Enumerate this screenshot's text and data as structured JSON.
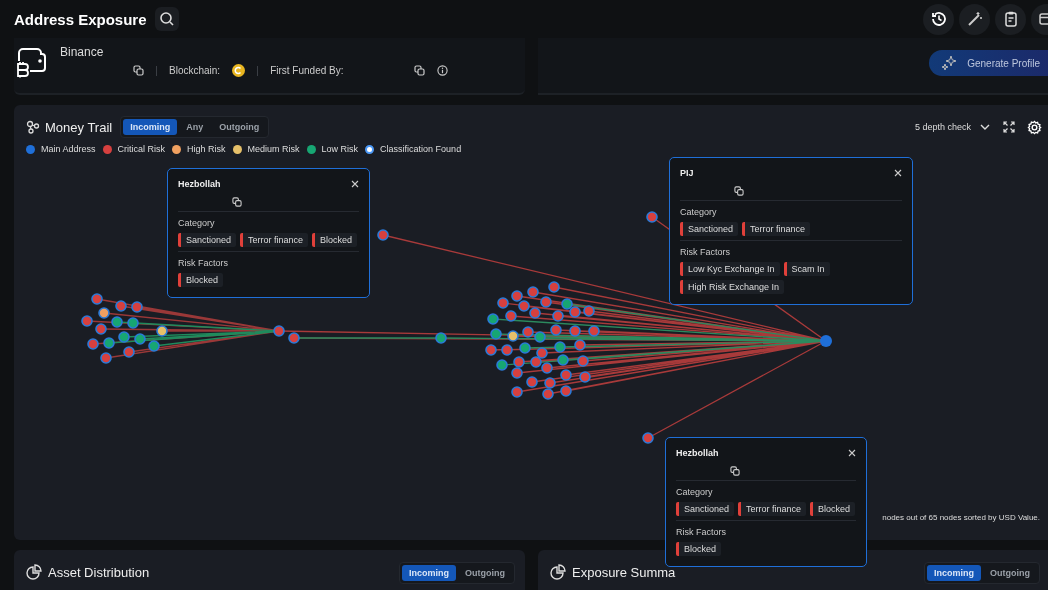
{
  "header": {
    "title": "Address Exposure"
  },
  "profile": {
    "name": "Binance",
    "blockchain_label": "Blockchain:",
    "first_funded_label": "First Funded By:"
  },
  "generate_button": {
    "label": "Generate Profile"
  },
  "money_trail": {
    "title": "Money Trail",
    "tabs": [
      {
        "label": "Incoming",
        "selected": true
      },
      {
        "label": "Any",
        "selected": false
      },
      {
        "label": "Outgoing",
        "selected": false
      }
    ],
    "depth": "5 depth check",
    "legend": [
      {
        "label": "Main Address",
        "color": "#1f6fd8",
        "outlined": false
      },
      {
        "label": "Critical Risk",
        "color": "#d6403f",
        "outlined": false
      },
      {
        "label": "High Risk",
        "color": "#f0a060",
        "outlined": false
      },
      {
        "label": "Medium Risk",
        "color": "#e6c06a",
        "outlined": false
      },
      {
        "label": "Low Risk",
        "color": "#17a673",
        "outlined": false
      },
      {
        "label": "Classification Found",
        "color": "#ffffff",
        "outlined": true
      }
    ],
    "popups": [
      {
        "title": "Hezbollah",
        "category_label": "Category",
        "categories": [
          "Sanctioned",
          "Terror finance",
          "Blocked"
        ],
        "risk_label": "Risk Factors",
        "risk_factors": [
          "Blocked"
        ]
      },
      {
        "title": "PIJ",
        "category_label": "Category",
        "categories": [
          "Sanctioned",
          "Terror finance"
        ],
        "risk_label": "Risk Factors",
        "risk_factors": [
          "Low Kyc Exchange In",
          "Scam In",
          "High Risk Exchange In"
        ]
      },
      {
        "title": "Hezbollah",
        "category_label": "Category",
        "categories": [
          "Sanctioned",
          "Terror finance",
          "Blocked"
        ],
        "risk_label": "Risk Factors",
        "risk_factors": [
          "Blocked"
        ]
      }
    ],
    "footer": "nodes out of 65 nodes sorted by USD Value."
  },
  "bottom_cards": [
    {
      "title": "Asset Distribution",
      "tabs": [
        {
          "label": "Incoming",
          "selected": true
        },
        {
          "label": "Outgoing",
          "selected": false
        }
      ]
    },
    {
      "title": "Exposure Summa",
      "tabs": [
        {
          "label": "Incoming",
          "selected": true
        },
        {
          "label": "Outgoing",
          "selected": false
        }
      ]
    }
  ]
}
